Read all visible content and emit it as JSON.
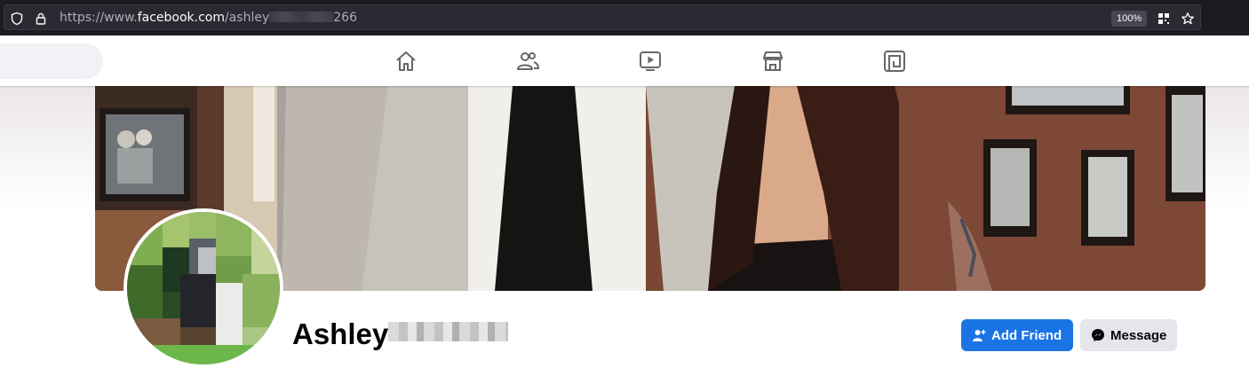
{
  "browser": {
    "url_prefix": "https://www.",
    "url_host": "facebook.com",
    "url_path": "/ashley",
    "url_suffix": "266",
    "zoom": "100%"
  },
  "nav": {
    "icons": [
      "home-icon",
      "friends-icon",
      "watch-icon",
      "marketplace-icon",
      "gaming-icon"
    ]
  },
  "profile": {
    "first_name": "Ashley",
    "add_friend_label": "Add Friend",
    "message_label": "Message"
  },
  "colors": {
    "primary_blue": "#1b74e4",
    "secondary_gray": "#e4e6eb"
  }
}
